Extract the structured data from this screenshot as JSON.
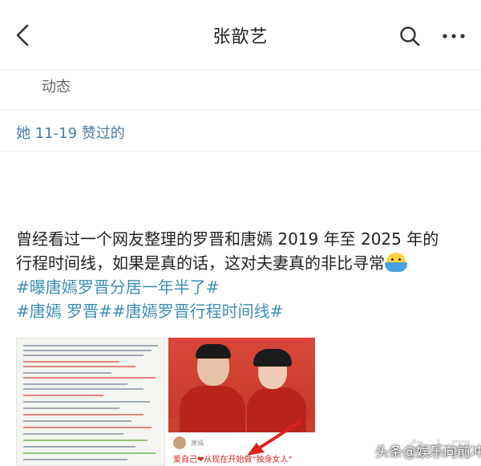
{
  "header": {
    "title": "张歆艺",
    "back_icon": "chevron-left-icon",
    "search_icon": "search-icon",
    "more_icon": "more-horizontal-icon"
  },
  "tabs": {
    "dongtai_label": "动态"
  },
  "liked": {
    "text": "她 11-19 赞过的"
  },
  "post": {
    "line1": "曾经看过一个网友整理的罗晋和唐嫣 2019 年至 2025 年的",
    "line2": "行程时间线，如果是真的话，这对夫妻真的非比寻常",
    "hashtag1": "#曝唐嫣罗晋分居一年半了#",
    "hashtag2": "#唐嫣 罗晋#",
    "hashtag3": "#唐嫣罗晋行程时间线#",
    "emoji": "swimming-emoji"
  },
  "images": {
    "photo_caption": "爱自己❤从现在开始做“独身女人”",
    "photo_caption_name": "唐嫣"
  },
  "watermark": {
    "text": "头条@娱乐向前冲",
    "logo": "名木网"
  },
  "colors": {
    "hashtag": "#3d8fb5",
    "liked_text": "#4a7ba8",
    "caption_red": "#d9231c"
  }
}
